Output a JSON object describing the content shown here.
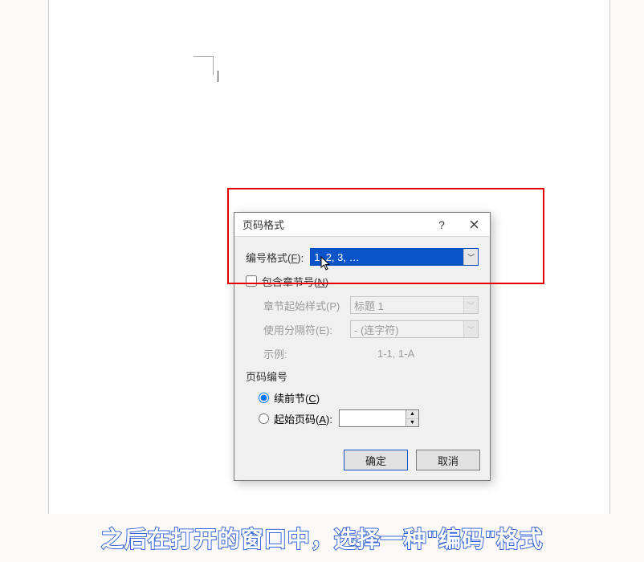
{
  "dialog": {
    "title": "页码格式",
    "help_label": "?",
    "number_format_label": "编号格式(",
    "number_format_key": "F",
    "number_format_label_after": "):",
    "number_format_value": "1, 2, 3, …",
    "include_chapter_label": "包含章节号(",
    "include_chapter_key": "N",
    "include_chapter_label_after": ")",
    "chapter_style_label": "章节起始样式(P)",
    "chapter_style_value": "标题 1",
    "separator_label": "使用分隔符(E):",
    "separator_value": "-  (连字符)",
    "example_label": "示例:",
    "example_value": "1-1, 1-A",
    "page_numbering_group": "页码编号",
    "continue_label": "续前节(",
    "continue_key": "C",
    "continue_label_after": ")",
    "start_at_label": "起始页码(",
    "start_at_key": "A",
    "start_at_label_after": "):",
    "ok_label": "确定",
    "cancel_label": "取消"
  },
  "caption": "之后在打开的窗口中，选择一种\"编码\"格式"
}
